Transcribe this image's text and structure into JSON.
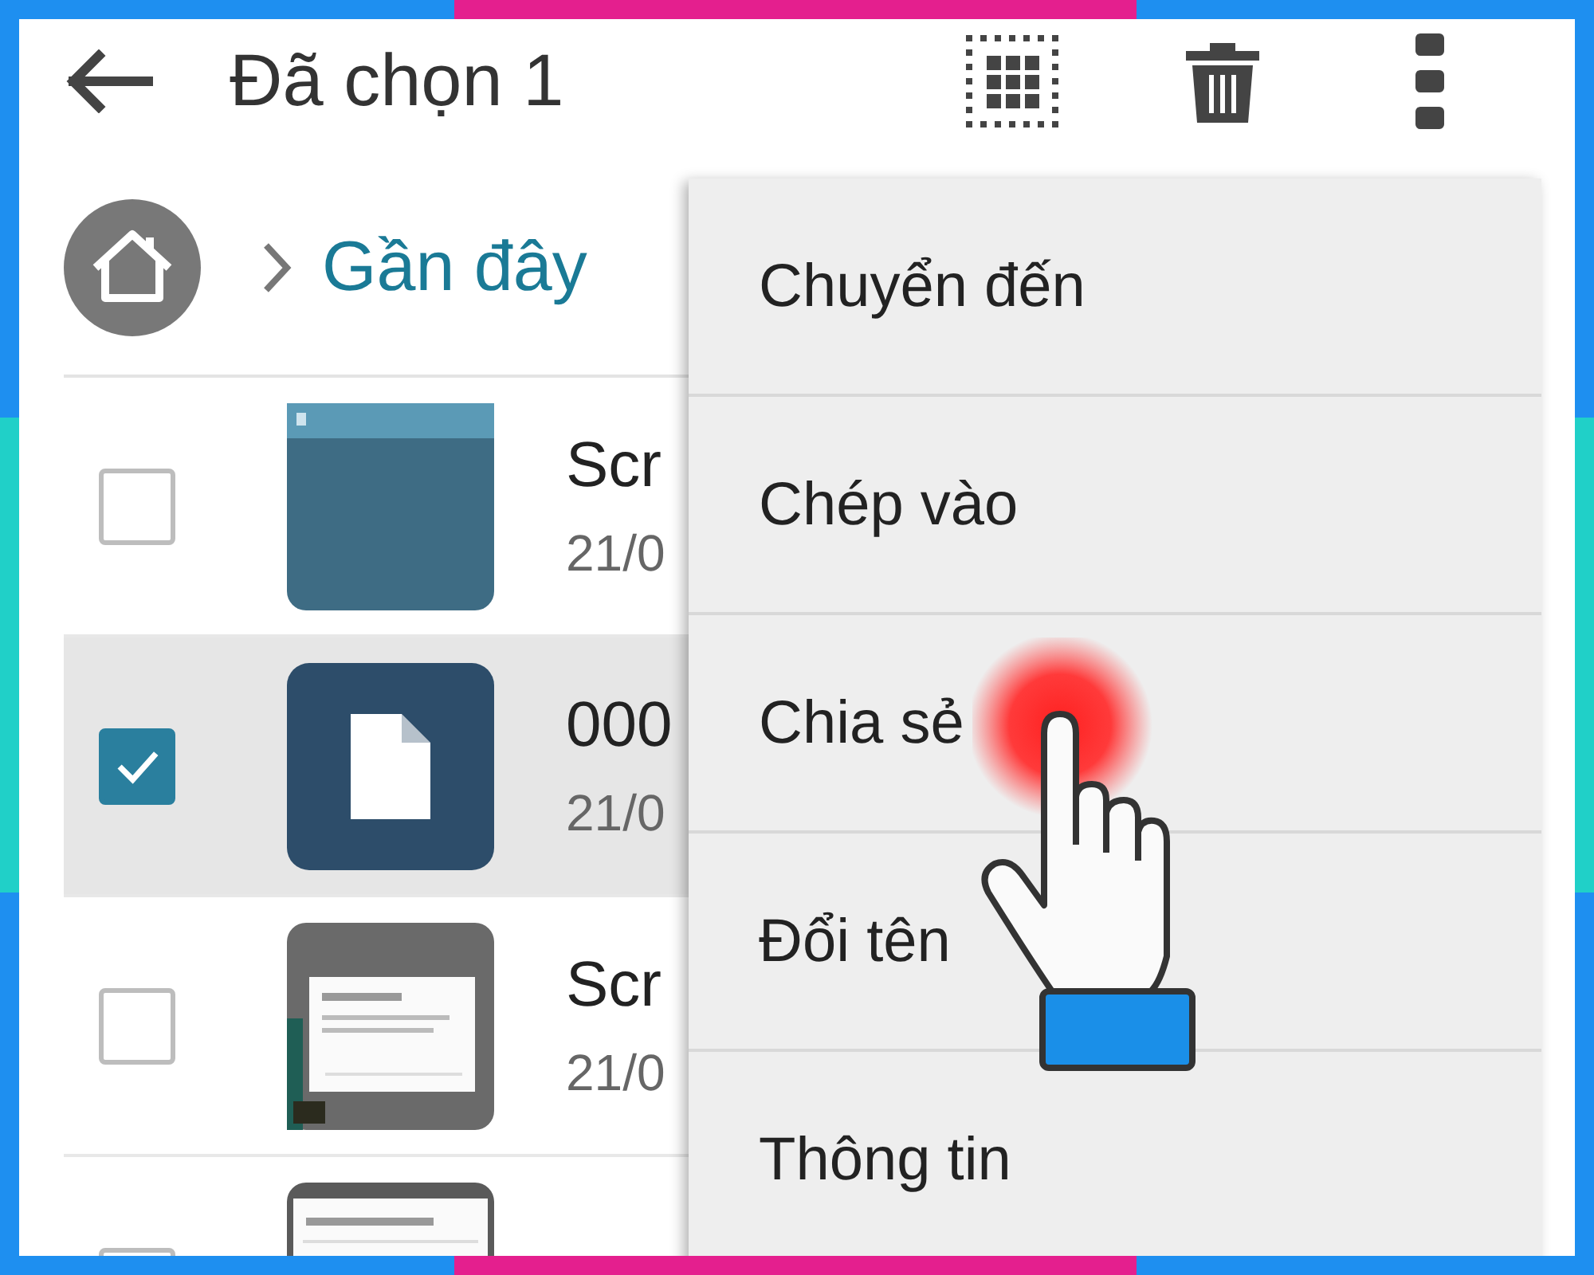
{
  "app_bar": {
    "title": "Đã chọn 1"
  },
  "breadcrumb": {
    "label": "Gần đây"
  },
  "files": [
    {
      "kind": "picture",
      "title": "Scr",
      "date": "21/0",
      "selected": false,
      "checked": false
    },
    {
      "kind": "file",
      "title": "000",
      "date": "21/0",
      "selected": true,
      "checked": true
    },
    {
      "kind": "picture",
      "title": "Scr",
      "date": "21/0",
      "selected": false,
      "checked": false
    },
    {
      "kind": "picture",
      "selected": false,
      "checked": false
    }
  ],
  "menu": {
    "items": [
      {
        "label": "Chuyển đến"
      },
      {
        "label": "Chép vào"
      },
      {
        "label": "Chia sẻ"
      },
      {
        "label": "Đổi tên"
      },
      {
        "label": "Thông tin"
      }
    ]
  }
}
